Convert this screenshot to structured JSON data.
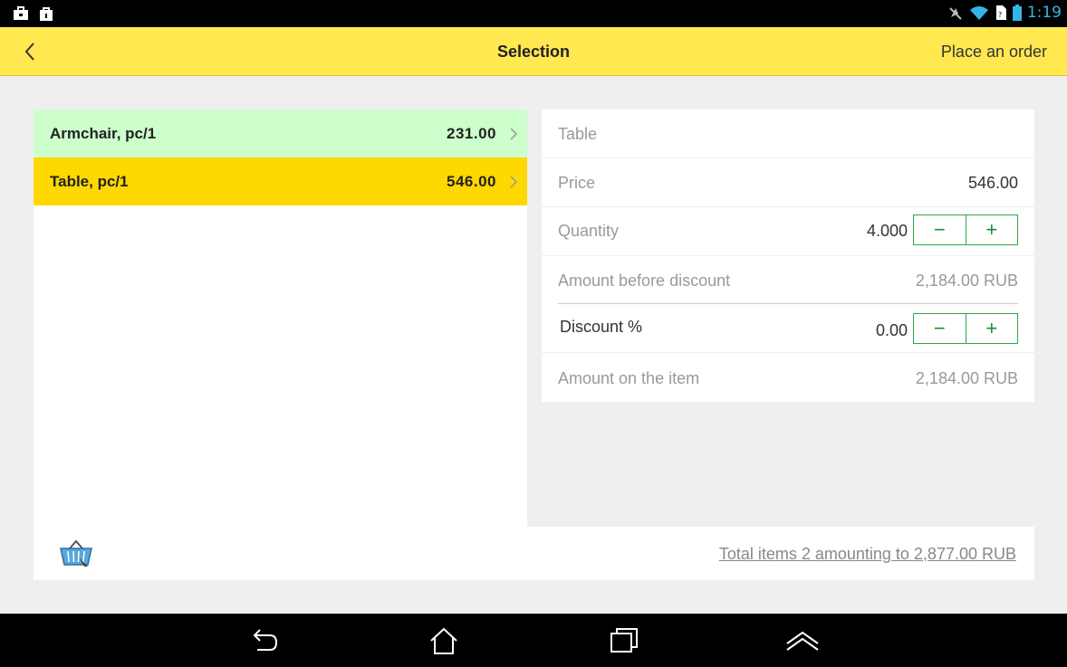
{
  "status_bar": {
    "time": "1:19"
  },
  "header": {
    "title": "Selection",
    "action": "Place an order"
  },
  "items": [
    {
      "name": "Armchair, pc/1",
      "price": "231.00"
    },
    {
      "name": "Table, pc/1",
      "price": "546.00"
    }
  ],
  "detail": {
    "item_name": "Table",
    "price_label": "Price",
    "price_value": "546.00",
    "quantity_label": "Quantity",
    "quantity_value": "4.000",
    "amount_before_label": "Amount before discount",
    "amount_before_value": "2,184.00 RUB",
    "discount_label": "Discount %",
    "discount_value": "0.00",
    "amount_item_label": "Amount on the item",
    "amount_item_value": "2,184.00 RUB",
    "minus": "−",
    "plus": "+"
  },
  "footer": {
    "total_text": "Total items 2 amounting to 2,877.00 RUB"
  },
  "colors": {
    "header_bg": "#ffe850",
    "selected_item": "#ffd800",
    "other_item": "#ccffcc",
    "stepper_accent": "#2aa84a"
  },
  "icons": [
    "briefcase-icon",
    "shopping-bag-icon",
    "no-sound-icon",
    "wifi-icon",
    "sim-icon",
    "battery-icon",
    "back-arrow-icon",
    "chevron-right-icon",
    "basket-icon",
    "nav-back-icon",
    "nav-home-icon",
    "nav-recent-icon",
    "nav-up-icon"
  ]
}
